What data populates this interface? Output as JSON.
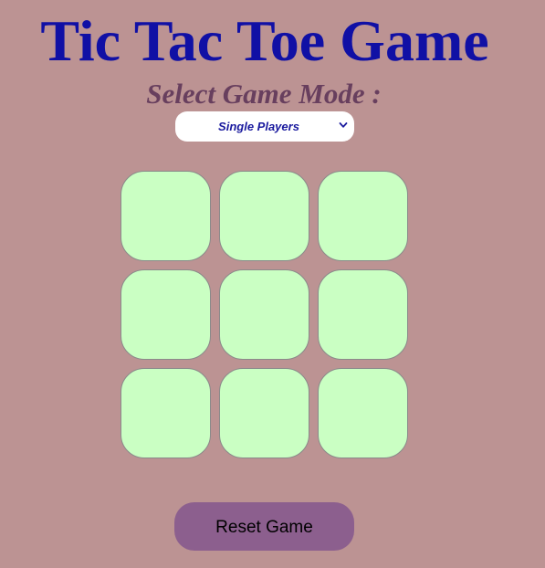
{
  "title": "Tic Tac Toe Game",
  "mode_label": "Select Game Mode :",
  "mode_select": {
    "selected": "Single Players",
    "icon": "chevron-down-icon"
  },
  "board": {
    "cells": [
      "",
      "",
      "",
      "",
      "",
      "",
      "",
      "",
      ""
    ]
  },
  "reset_label": "Reset Game",
  "colors": {
    "background": "#bc9393",
    "title": "#1010a5",
    "mode_label": "#683f5e",
    "select_text": "#1a1a9e",
    "cell": "#caffc3",
    "cell_border": "#8a8a8a",
    "reset_button": "#8c5f8e"
  }
}
